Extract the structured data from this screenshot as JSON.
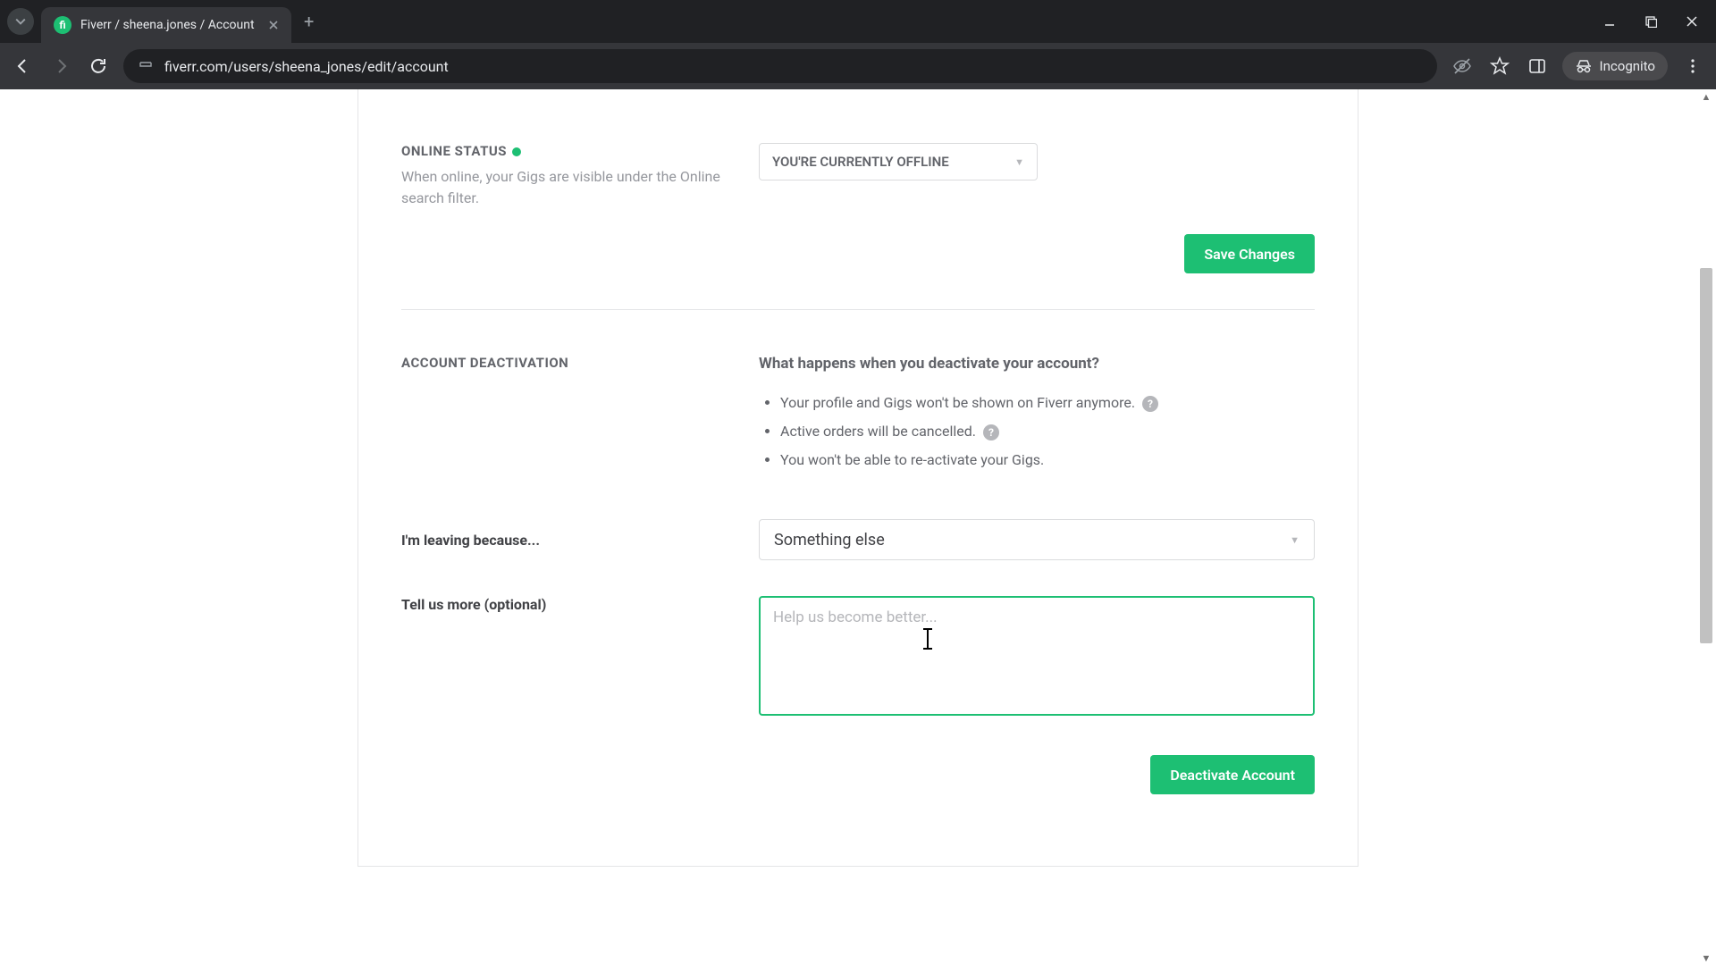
{
  "browser": {
    "tab_title": "Fiverr / sheena.jones / Account",
    "url": "fiverr.com/users/sheena_jones/edit/account",
    "incognito_label": "Incognito"
  },
  "online": {
    "label": "ONLINE STATUS",
    "desc": "When online, your Gigs are visible under the Online search filter.",
    "select_value": "YOU'RE CURRENTLY OFFLINE"
  },
  "save_button": "Save Changes",
  "deact": {
    "label": "ACCOUNT DEACTIVATION",
    "question": "What happens when you deactivate your account?",
    "items": [
      "Your profile and Gigs won't be shown on Fiverr anymore.",
      "Active orders will be cancelled.",
      "You won't be able to re-activate your Gigs."
    ]
  },
  "leaving": {
    "label": "I'm leaving because...",
    "value": "Something else"
  },
  "more": {
    "label": "Tell us more (optional)",
    "placeholder": "Help us become better..."
  },
  "deactivate_button": "Deactivate Account"
}
